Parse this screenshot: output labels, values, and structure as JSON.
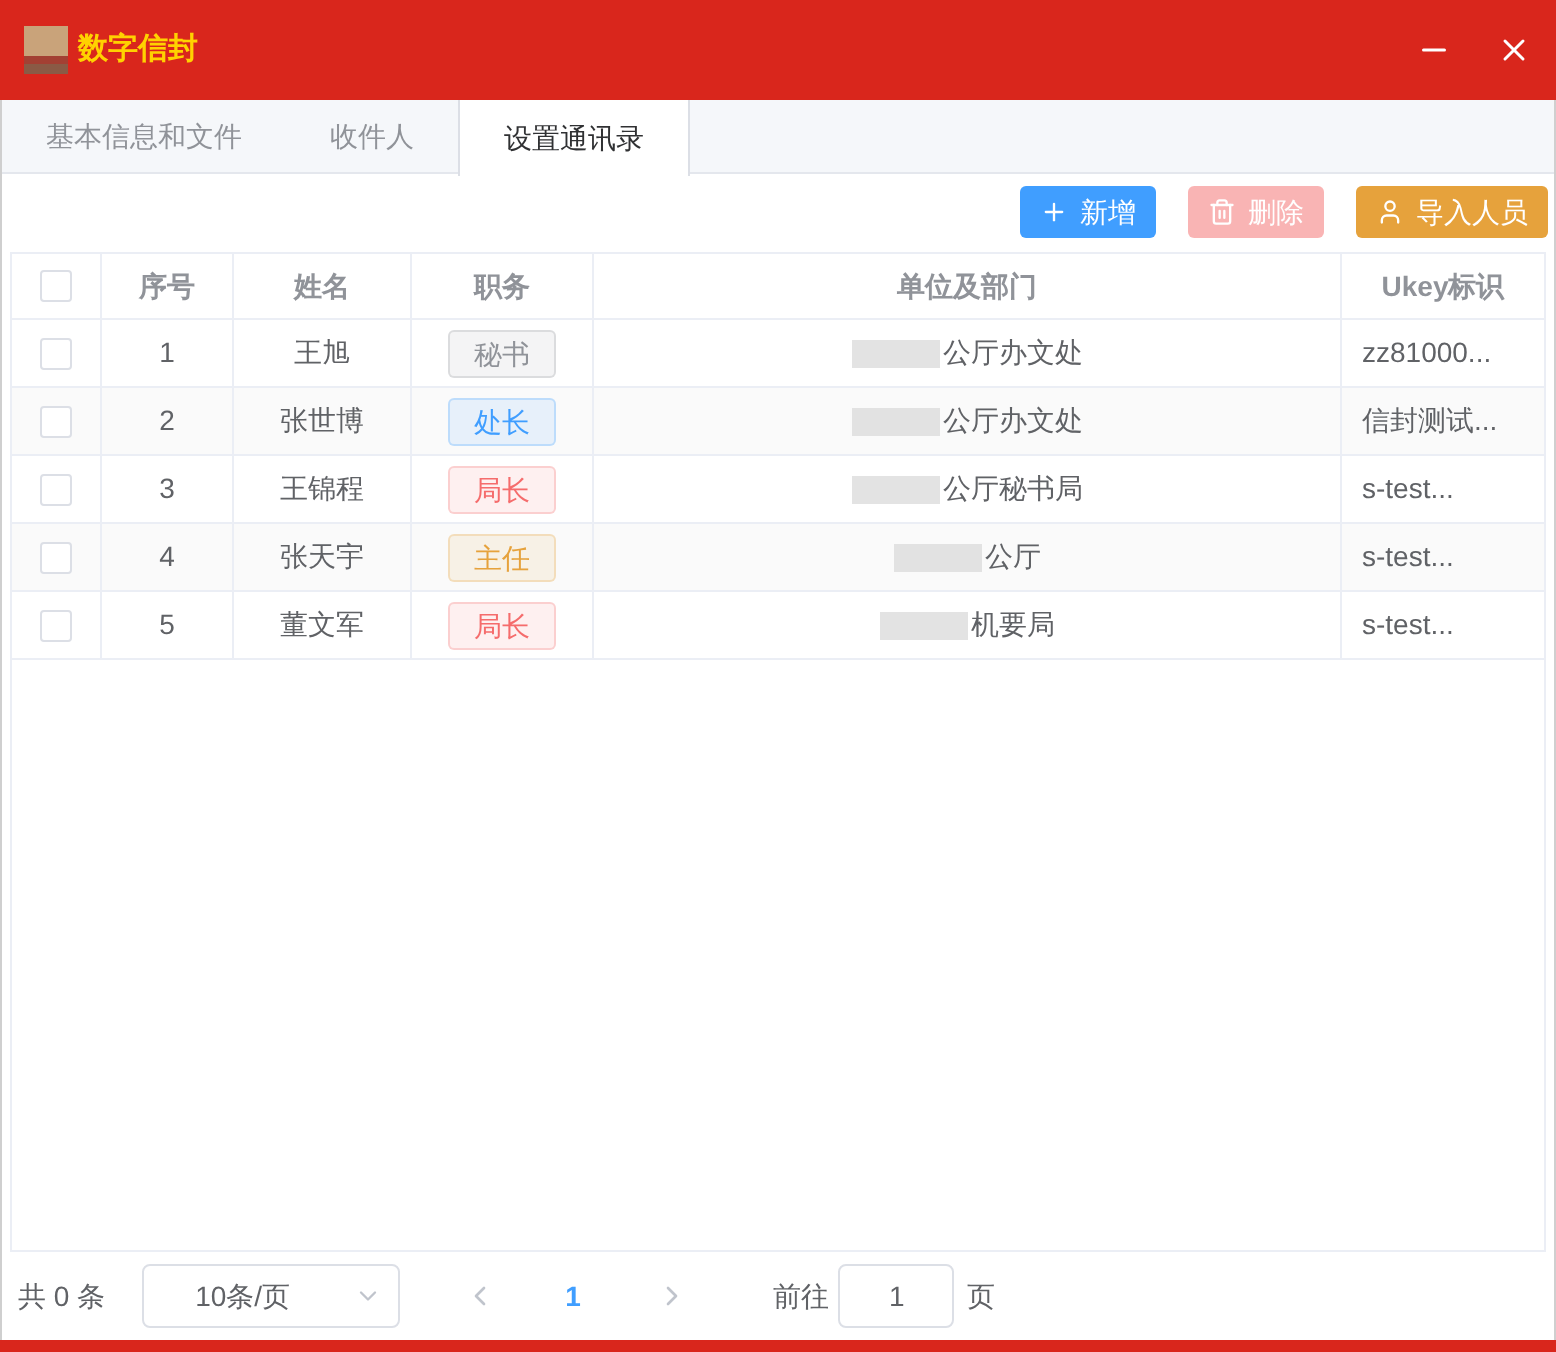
{
  "window": {
    "title": "数字信封"
  },
  "tabs": [
    {
      "label": "基本信息和文件",
      "selected": false
    },
    {
      "label": "收件人",
      "selected": false
    },
    {
      "label": "设置通讯录",
      "selected": true
    }
  ],
  "toolbar": [
    {
      "label": "新增",
      "kind": "add",
      "disabled": false
    },
    {
      "label": "删除",
      "kind": "delete",
      "disabled": true
    },
    {
      "label": "导入人员",
      "kind": "import",
      "disabled": false
    }
  ],
  "table": {
    "select_all": {
      "checked": false
    },
    "columns": [
      "序号",
      "姓名",
      "职务",
      "单位及部门",
      "Ukey标识"
    ],
    "rows": [
      {
        "checked": false,
        "index": "1",
        "name": "王旭",
        "position": "秘书",
        "color": "#909399",
        "department": "公厅办文处",
        "ukey": "zz81000..."
      },
      {
        "checked": false,
        "index": "2",
        "name": "张世博",
        "position": "处长",
        "color": "#409eff",
        "department": "公厅办文处",
        "ukey": "信封测试..."
      },
      {
        "checked": false,
        "index": "3",
        "name": "王锦程",
        "position": "局长",
        "color": "#f56c6c",
        "department": "公厅秘书局",
        "ukey": "s-test..."
      },
      {
        "checked": false,
        "index": "4",
        "name": "张天宇",
        "position": "主任",
        "color": "#e6a23c",
        "department": "公厅",
        "ukey": "s-test..."
      },
      {
        "checked": false,
        "index": "5",
        "name": "董文军",
        "position": "局长",
        "color": "#f56c6c",
        "department": "机要局",
        "ukey": "s-test..."
      }
    ]
  },
  "pagination": {
    "total": "共 0 条",
    "page_size": "10条/页",
    "current_page": "1",
    "goto_label": "前往",
    "goto_value": "1",
    "page_suffix": "页"
  }
}
